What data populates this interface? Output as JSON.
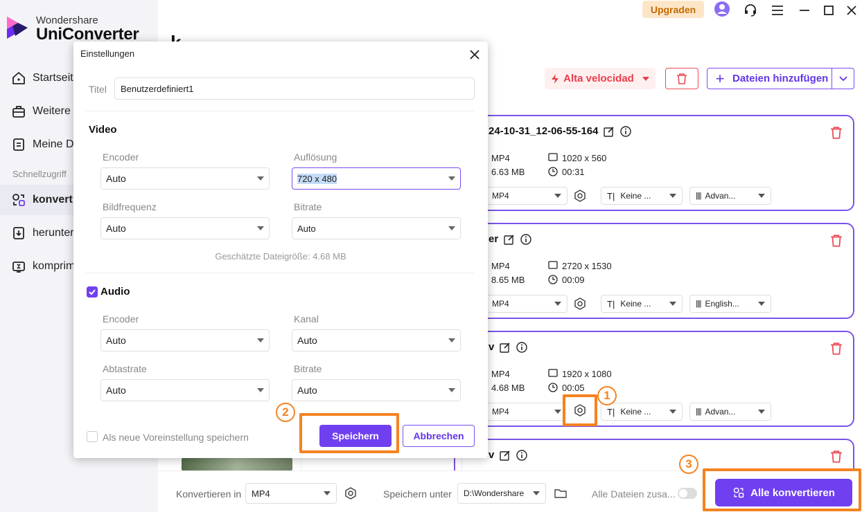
{
  "app": {
    "brand_small": "Wondershare",
    "brand_big": "UniConverter",
    "upgrade_label": "Upgraden"
  },
  "sidebar": {
    "items": [
      {
        "label": "Startseite",
        "icon": "home-icon"
      },
      {
        "label": "Weitere",
        "icon": "toolbox-icon"
      },
      {
        "label": "Meine D",
        "icon": "file-icon"
      }
    ],
    "quick_label": "Schnellzugriff",
    "quick_items": [
      {
        "label": "konvert",
        "icon": "convert-icon",
        "active": true
      },
      {
        "label": "herunter",
        "icon": "download-icon"
      },
      {
        "label": "komprim",
        "icon": "compress-icon"
      }
    ]
  },
  "main": {
    "page_title": "k",
    "alta_label": "Alta velocidad",
    "add_files_label": "Dateien hinzufügen",
    "files": [
      {
        "name": "24-10-31_12-06-55-164",
        "format": "MP4",
        "size": "6.63 MB",
        "resolution": "1020 x 560",
        "duration": "00:31",
        "out_format": "MP4",
        "subtitle": "Keine ...",
        "audio": "Advan..."
      },
      {
        "name": "er",
        "format": "MP4",
        "size": "8.65 MB",
        "resolution": "2720 x 1530",
        "duration": "00:09",
        "out_format": "MP4",
        "subtitle": "Keine ...",
        "audio": "English..."
      },
      {
        "name": "v",
        "format": "MP4",
        "size": "4.68 MB",
        "resolution": "1920 x 1080",
        "duration": "00:05",
        "out_format": "MP4",
        "subtitle": "Keine ...",
        "audio": "Advan..."
      },
      {
        "name": "v"
      }
    ]
  },
  "bottom": {
    "convert_in_label": "Konvertieren in",
    "convert_in_value": "MP4",
    "save_under_label": "Speichern unter",
    "save_under_value": "D:\\Wondershare",
    "merge_label": "Alle Dateien zusa...",
    "convert_all_label": "Alle konvertieren"
  },
  "dialog": {
    "title": "Einstellungen",
    "title_label": "Titel",
    "title_value": "Benutzerdefiniert1",
    "video_section": "Video",
    "video_encoder_label": "Encoder",
    "video_encoder_value": "Auto",
    "resolution_label": "Auflösung",
    "resolution_value": "720 x 480",
    "framerate_label": "Bildfrequenz",
    "framerate_value": "Auto",
    "video_bitrate_label": "Bitrate",
    "video_bitrate_value": "Auto",
    "estimated_size": "Geschätzte Dateigröße: 4.68 MB",
    "audio_section": "Audio",
    "audio_encoder_label": "Encoder",
    "audio_encoder_value": "Auto",
    "channel_label": "Kanal",
    "channel_value": "Auto",
    "samplerate_label": "Abtastrate",
    "samplerate_value": "Auto",
    "audio_bitrate_label": "Bitrate",
    "audio_bitrate_value": "Auto",
    "save_preset_label": "Als neue Voreinstellung speichern",
    "save_button": "Speichern",
    "cancel_button": "Abbrechen"
  },
  "annotations": {
    "step1": "1",
    "step2": "2",
    "step3": "3"
  },
  "colors": {
    "accent": "#7040f0",
    "highlight": "#f58220",
    "danger": "#ea3d4a"
  }
}
